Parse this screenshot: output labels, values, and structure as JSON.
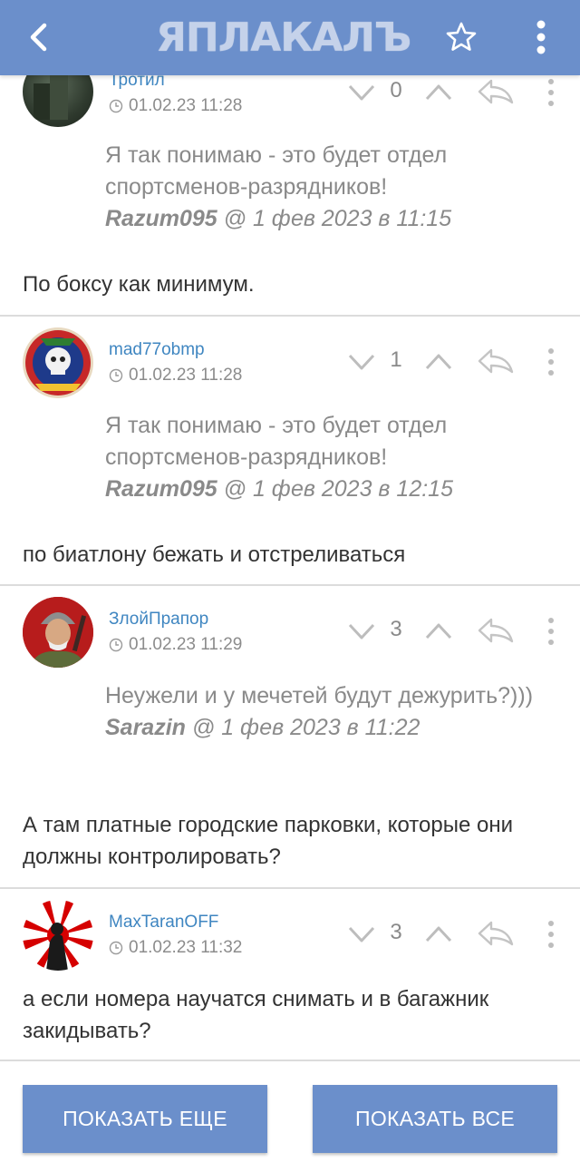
{
  "header": {
    "logo_text": "ЯПЛАКАЛЪ",
    "back_icon": "chevron-left-icon",
    "favorite_icon": "star-outline-icon",
    "menu_icon": "vertical-dots-icon",
    "background_color": "#6b8fcb"
  },
  "comments": [
    {
      "username": "Тротил",
      "time": "01.02.23 11:28",
      "rating": "0",
      "quote_text": "Я так понимаю - это будет отдел спортсменов-разрядников!",
      "quote_author": "Razum095",
      "quote_meta": " @ 1 фев 2023 в 11:15",
      "text": "По боксу как минимум."
    },
    {
      "username": "mad77obmp",
      "time": "01.02.23 11:28",
      "rating": "1",
      "quote_text": "Я так понимаю - это будет отдел спортсменов-разрядников!",
      "quote_author": "Razum095",
      "quote_meta": " @ 1 фев 2023 в 12:15",
      "text": "по биатлону бежать и отстреливаться"
    },
    {
      "username": "ЗлойПрапор",
      "time": "01.02.23 11:29",
      "rating": "3",
      "quote_text": "Неужели и у мечетей будут дежурить?)))",
      "quote_author": "Sarazin",
      "quote_meta": " @ 1 фев 2023 в 11:22",
      "text": "А там платные городские парковки, которые они должны контролировать?"
    },
    {
      "username": "MaxTaranOFF",
      "time": "01.02.23 11:32",
      "rating": "3",
      "text": "а если номера научатся снимать и в багажник закидывать?"
    }
  ],
  "buttons": {
    "show_more": "ПОКАЗАТЬ ЕЩЕ",
    "show_all": "ПОКАЗАТЬ ВСЕ"
  },
  "colors": {
    "accent": "#6b8fcb",
    "username": "#3f86c1",
    "muted": "#8a8a8a",
    "divider": "#dcdcdc"
  }
}
